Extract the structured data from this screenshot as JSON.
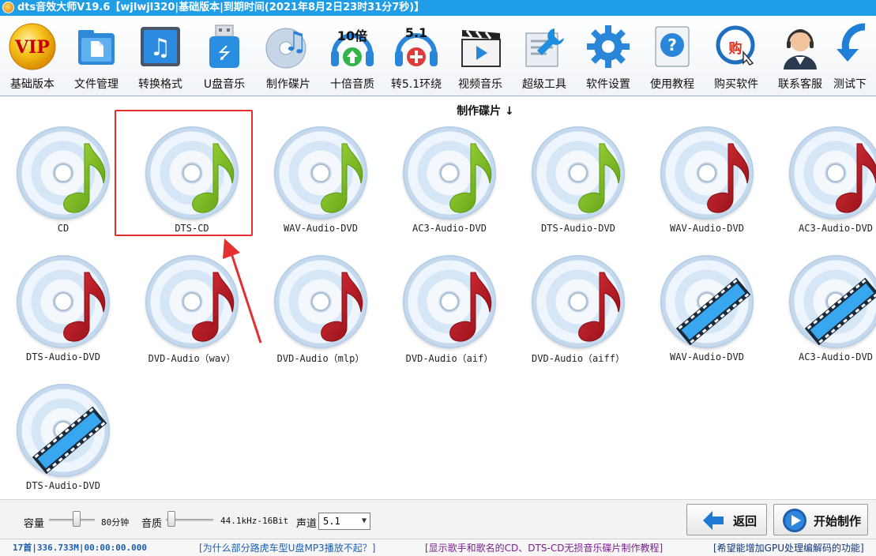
{
  "window": {
    "title": "dts音效大师V19.6【wjlwjl320|基础版本|到期时间(2021年8月2日23时31分7秒)】"
  },
  "toolbar": {
    "items": [
      {
        "label": "基础版本",
        "icon": "vip-icon"
      },
      {
        "label": "文件管理",
        "icon": "folder-icon"
      },
      {
        "label": "转换格式",
        "icon": "music-convert-icon"
      },
      {
        "label": "U盘音乐",
        "icon": "usb-drive-icon"
      },
      {
        "label": "制作碟片",
        "icon": "disc-icon"
      },
      {
        "label": "十倍音质",
        "icon": "headphones-10x-icon",
        "badge": "10倍"
      },
      {
        "label": "转5.1环绕",
        "icon": "headphones-51-icon",
        "badge": "5.1"
      },
      {
        "label": "视频音乐",
        "icon": "clapperboard-icon"
      },
      {
        "label": "超级工具",
        "icon": "wrench-icon"
      },
      {
        "label": "软件设置",
        "icon": "gear-icon"
      },
      {
        "label": "使用教程",
        "icon": "help-book-icon"
      },
      {
        "label": "购买软件",
        "icon": "buy-icon",
        "badge": "购"
      },
      {
        "label": "联系客服",
        "icon": "customer-service-icon"
      },
      {
        "label": "测试下",
        "icon": "download-arrow-icon"
      }
    ]
  },
  "section": {
    "title": "制作碟片 ↓"
  },
  "discs": [
    {
      "label": "CD",
      "style": "green"
    },
    {
      "label": "DTS-CD",
      "style": "green"
    },
    {
      "label": "WAV-Audio-DVD",
      "style": "green"
    },
    {
      "label": "AC3-Audio-DVD",
      "style": "green"
    },
    {
      "label": "DTS-Audio-DVD",
      "style": "green"
    },
    {
      "label": "WAV-Audio-DVD",
      "style": "red"
    },
    {
      "label": "AC3-Audio-DVD",
      "style": "red"
    },
    {
      "label": "DTS-Audio-DVD",
      "style": "red"
    },
    {
      "label": "DVD-Audio（wav）",
      "style": "red"
    },
    {
      "label": "DVD-Audio（mlp）",
      "style": "red"
    },
    {
      "label": "DVD-Audio（aif）",
      "style": "red"
    },
    {
      "label": "DVD-Audio（aiff）",
      "style": "red"
    },
    {
      "label": "WAV-Audio-DVD",
      "style": "film"
    },
    {
      "label": "AC3-Audio-DVD",
      "style": "film"
    },
    {
      "label": "DTS-Audio-DVD",
      "style": "film"
    }
  ],
  "controls": {
    "capacity_label": "容量",
    "capacity_value": "80分钟",
    "capacity_level": 0.6,
    "quality_label": "音质",
    "quality_value": "44.1kHz-16Bit",
    "quality_level": 0.0,
    "channel_label": "声道",
    "channel_value": "5.1",
    "back_label": "返回",
    "start_label": "开始制作"
  },
  "status": {
    "summary": "17首|336.733M|00:00:00.000",
    "link1": "[为什么部分路虎车型U盘MP3播放不起？]",
    "link2": "[显示歌手和歌名的CD、DTS-CD无损音乐碟片制作教程]",
    "link3": "[希望能增加GPU处理编解码的功能]"
  },
  "colors": {
    "titlebar": "#1f9de6",
    "highlight": "#e53030",
    "status_blue": "#1b5fb3",
    "status_purple": "#7a1f8f",
    "status_dark_blue": "#12357a"
  }
}
